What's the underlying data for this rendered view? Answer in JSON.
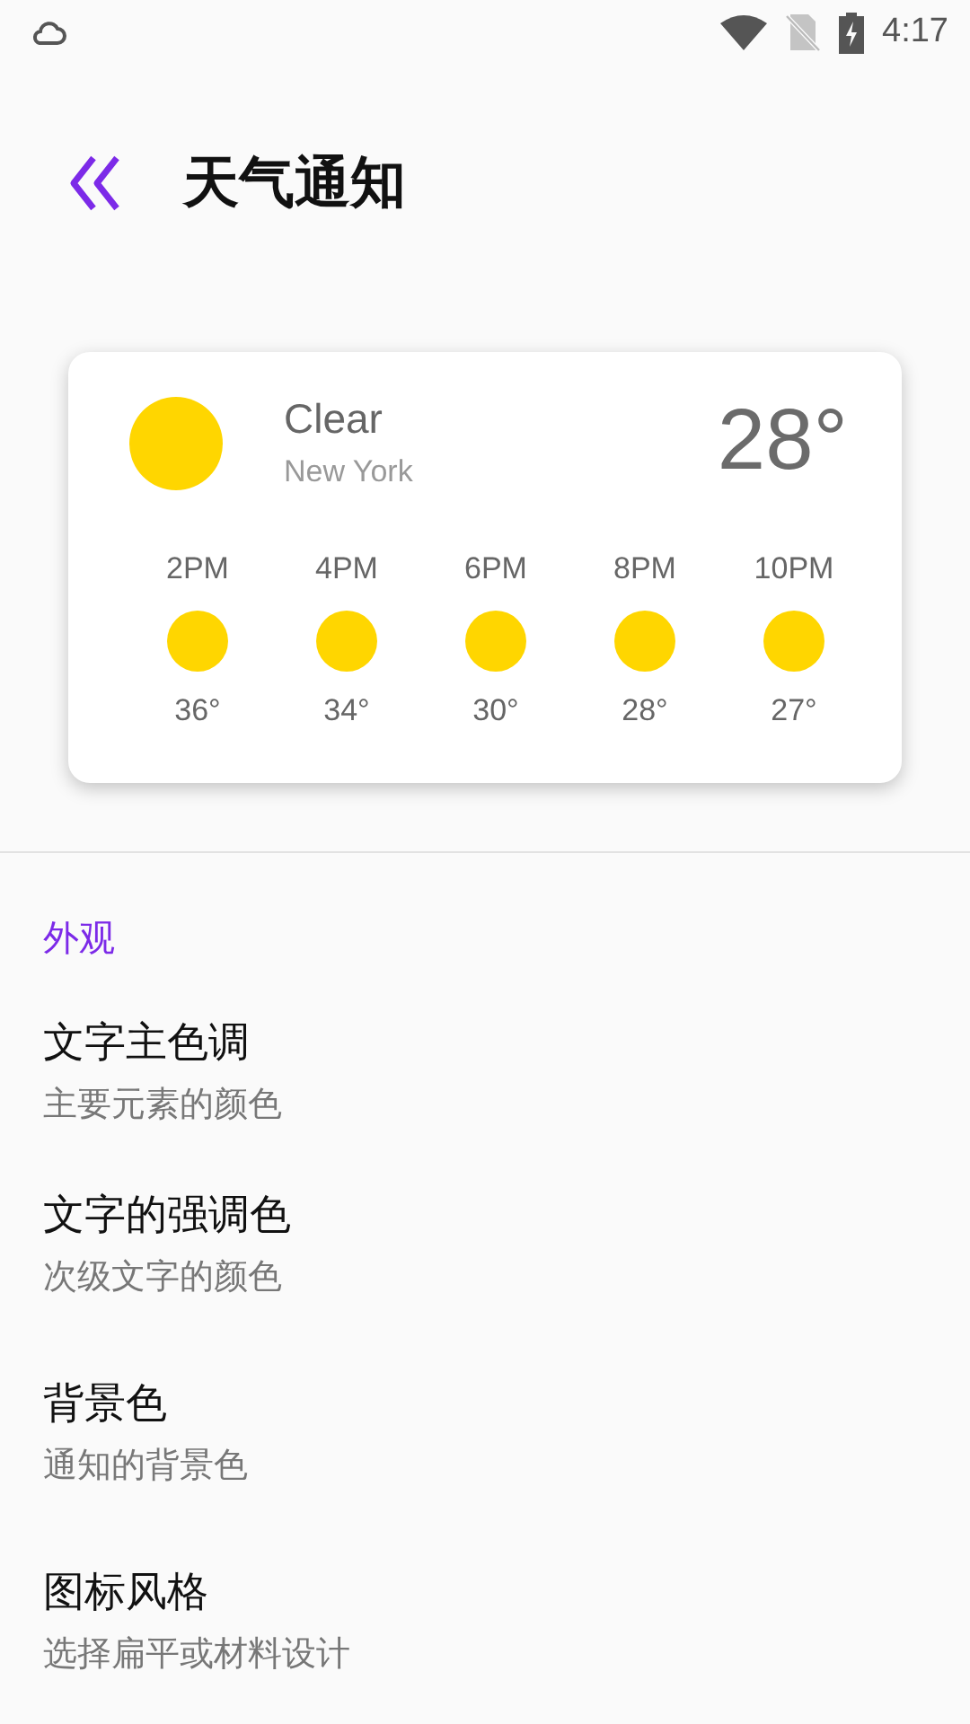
{
  "status_bar": {
    "time": "4:17"
  },
  "header": {
    "title": "天气通知"
  },
  "weather_card": {
    "condition": "Clear",
    "location": "New York",
    "temperature": "28°",
    "hourly": [
      {
        "time": "2PM",
        "temperature": "36°"
      },
      {
        "time": "4PM",
        "temperature": "34°"
      },
      {
        "time": "6PM",
        "temperature": "30°"
      },
      {
        "time": "8PM",
        "temperature": "28°"
      },
      {
        "time": "10PM",
        "temperature": "27°"
      }
    ]
  },
  "section": {
    "title": "外观",
    "items": [
      {
        "title": "文字主色调",
        "subtitle": "主要元素的颜色"
      },
      {
        "title": "文字的强调色",
        "subtitle": "次级文字的颜色"
      },
      {
        "title": "背景色",
        "subtitle": "通知的背景色"
      },
      {
        "title": "图标风格",
        "subtitle": "选择扁平或材料设计"
      }
    ]
  }
}
